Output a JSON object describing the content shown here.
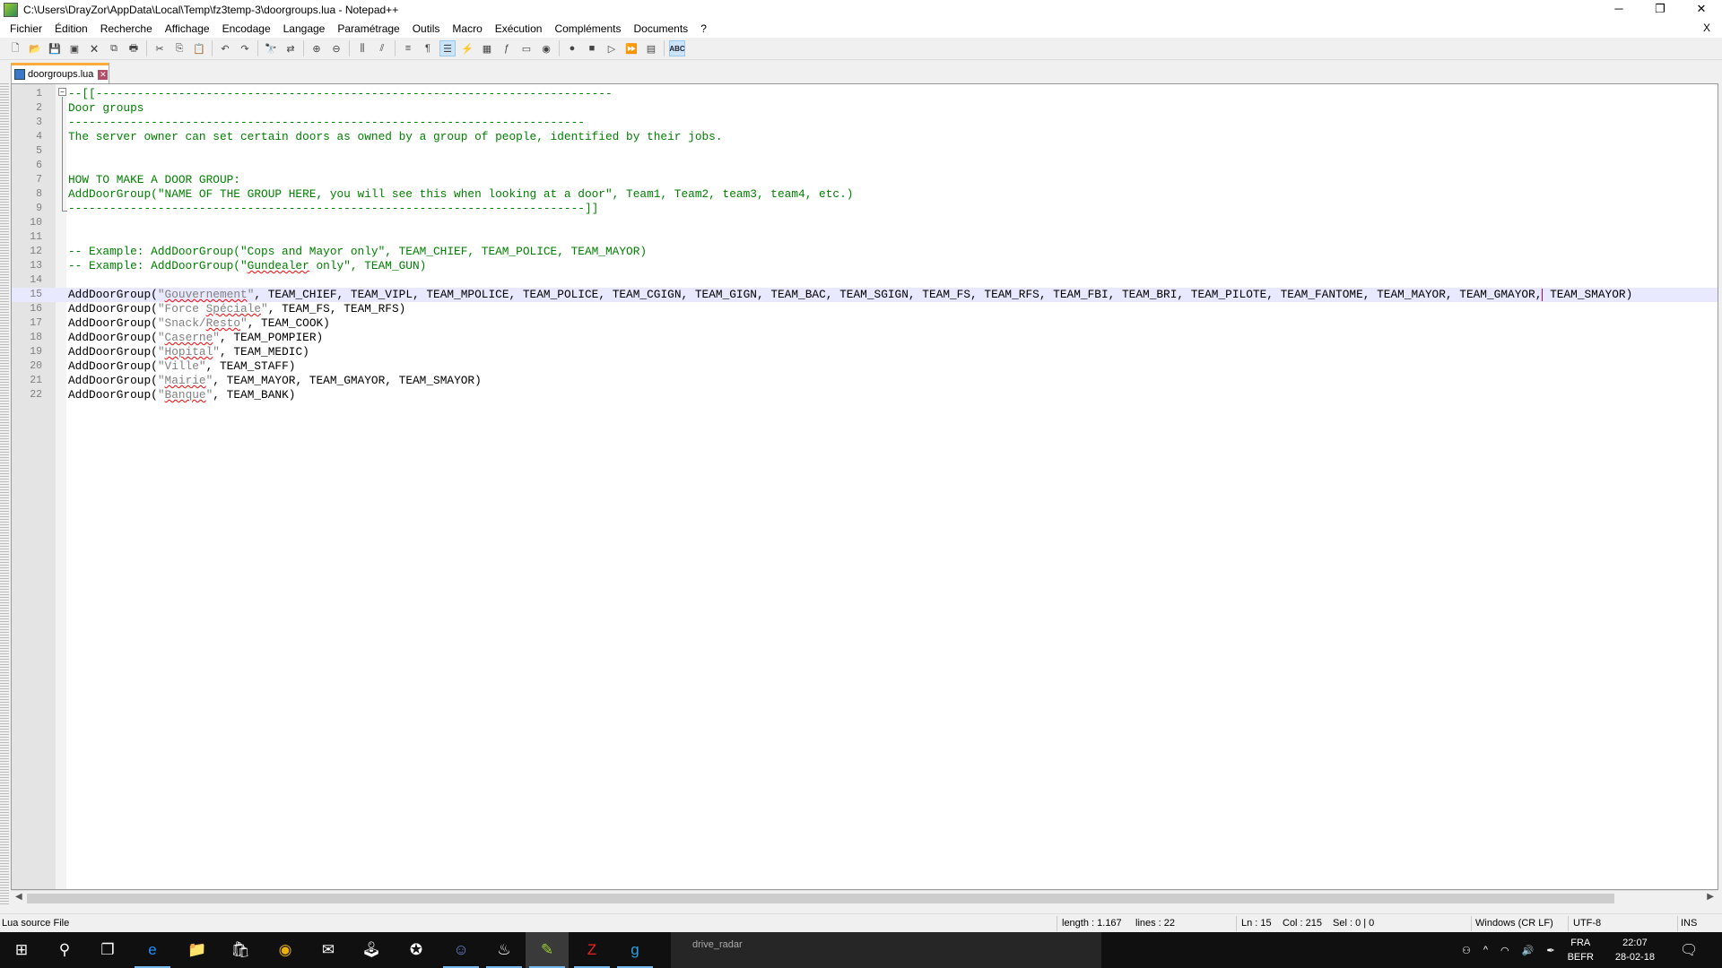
{
  "window": {
    "title": "C:\\Users\\DrayZor\\AppData\\Local\\Temp\\fz3temp-3\\doorgroups.lua - Notepad++",
    "minimize": "─",
    "restore": "❐",
    "close": "✕"
  },
  "menu": [
    "Fichier",
    "Édition",
    "Recherche",
    "Affichage",
    "Encodage",
    "Langage",
    "Paramétrage",
    "Outils",
    "Macro",
    "Exécution",
    "Compléments",
    "Documents",
    "?"
  ],
  "menu_close": "X",
  "toolbar": [
    {
      "icon": "new-file-icon",
      "g": "🗋"
    },
    {
      "icon": "open-file-icon",
      "g": "📂"
    },
    {
      "icon": "save-icon",
      "g": "💾"
    },
    {
      "icon": "save-all-icon",
      "g": "▣"
    },
    {
      "icon": "close-icon",
      "g": "🗙"
    },
    {
      "icon": "close-all-icon",
      "g": "⧉"
    },
    {
      "icon": "print-icon",
      "g": "🖶"
    },
    {
      "sep": true
    },
    {
      "icon": "cut-icon",
      "g": "✂"
    },
    {
      "icon": "copy-icon",
      "g": "⎘"
    },
    {
      "icon": "paste-icon",
      "g": "📋"
    },
    {
      "sep": true
    },
    {
      "icon": "undo-icon",
      "g": "↶"
    },
    {
      "icon": "redo-icon",
      "g": "↷"
    },
    {
      "sep": true
    },
    {
      "icon": "find-icon",
      "g": "🔭"
    },
    {
      "icon": "replace-icon",
      "g": "⇄"
    },
    {
      "sep": true
    },
    {
      "icon": "zoom-in-icon",
      "g": "⊕"
    },
    {
      "icon": "zoom-out-icon",
      "g": "⊖"
    },
    {
      "sep": true
    },
    {
      "icon": "sync-vertical-icon",
      "g": "⫼"
    },
    {
      "icon": "sync-horizontal-icon",
      "g": "⫽"
    },
    {
      "sep": true
    },
    {
      "icon": "word-wrap-icon",
      "g": "≡"
    },
    {
      "icon": "show-all-chars-icon",
      "g": "¶"
    },
    {
      "icon": "indent-guide-icon",
      "g": "☰",
      "active": true
    },
    {
      "icon": "udl-icon",
      "g": "⚡"
    },
    {
      "icon": "doc-map-icon",
      "g": "▦"
    },
    {
      "icon": "function-list-icon",
      "g": "ƒ"
    },
    {
      "icon": "folder-workspace-icon",
      "g": "▭"
    },
    {
      "icon": "monitoring-icon",
      "g": "◉"
    },
    {
      "sep": true
    },
    {
      "icon": "record-macro-icon",
      "g": "●"
    },
    {
      "icon": "stop-record-icon",
      "g": "■"
    },
    {
      "icon": "play-macro-icon",
      "g": "▷"
    },
    {
      "icon": "run-macro-multiple-icon",
      "g": "⏩"
    },
    {
      "icon": "save-macro-icon",
      "g": "▤"
    },
    {
      "sep": true
    },
    {
      "icon": "spell-check-icon",
      "g": "ABC",
      "active": true
    }
  ],
  "tab": {
    "label": "doorgroups.lua",
    "close": "✕"
  },
  "editor": {
    "current_line": 15,
    "lines": [
      [
        {
          "t": "--[[---------------------------------------------------------------------------",
          "c": "comment"
        }
      ],
      [
        {
          "t": "Door groups",
          "c": "comment"
        }
      ],
      [
        {
          "t": "---------------------------------------------------------------------------",
          "c": "comment"
        }
      ],
      [
        {
          "t": "The server owner can set certain doors as owned by a group of people, identified by their jobs.",
          "c": "comment"
        }
      ],
      [],
      [],
      [
        {
          "t": "HOW TO MAKE A DOOR GROUP:",
          "c": "comment"
        }
      ],
      [
        {
          "t": "AddDoorGroup(\"NAME OF THE GROUP HERE, you will see this when looking at a door\", Team1, Team2, team3, team4, etc.)",
          "c": "comment"
        }
      ],
      [
        {
          "t": "---------------------------------------------------------------------------]]",
          "c": "comment"
        }
      ],
      [],
      [],
      [
        {
          "t": "-- Example: AddDoorGroup(\"Cops and Mayor only\", TEAM_CHIEF, TEAM_POLICE, TEAM_MAYOR)",
          "c": "comment"
        }
      ],
      [
        {
          "t": "-- Example: AddDoorGroup(\"",
          "c": "comment"
        },
        {
          "t": "Gundealer",
          "c": "comment spell"
        },
        {
          "t": " only\", TEAM_GUN)",
          "c": "comment"
        }
      ],
      [],
      [
        {
          "t": "AddDoorGroup(",
          "c": ""
        },
        {
          "t": "\"",
          "c": "string"
        },
        {
          "t": "Gouvernement",
          "c": "string spell"
        },
        {
          "t": "\"",
          "c": "string"
        },
        {
          "t": ", TEAM_CHIEF, TEAM_VIPL, TEAM_MPOLICE, TEAM_POLICE, TEAM_CGIGN, TEAM_GIGN, TEAM_BAC, TEAM_SGIGN, TEAM_FS, TEAM_RFS, TEAM_FBI, TEAM_BRI, TEAM_PILOTE, TEAM_FANTOME, TEAM_MAYOR, TEAM_GMAYOR,",
          "c": ""
        },
        {
          "t": "",
          "c": "caret"
        },
        {
          "t": " TEAM_SMAYOR)",
          "c": ""
        }
      ],
      [
        {
          "t": "AddDoorGroup(",
          "c": ""
        },
        {
          "t": "\"Force ",
          "c": "string"
        },
        {
          "t": "Spéciale",
          "c": "string spell"
        },
        {
          "t": "\"",
          "c": "string"
        },
        {
          "t": ", TEAM_FS, TEAM_RFS)",
          "c": ""
        }
      ],
      [
        {
          "t": "AddDoorGroup(",
          "c": ""
        },
        {
          "t": "\"Snack/",
          "c": "string"
        },
        {
          "t": "Resto",
          "c": "string spell"
        },
        {
          "t": "\"",
          "c": "string"
        },
        {
          "t": ", TEAM_COOK)",
          "c": ""
        }
      ],
      [
        {
          "t": "AddDoorGroup(",
          "c": ""
        },
        {
          "t": "\"",
          "c": "string"
        },
        {
          "t": "Caserne",
          "c": "string spell"
        },
        {
          "t": "\"",
          "c": "string"
        },
        {
          "t": ", TEAM_POMPIER)",
          "c": ""
        }
      ],
      [
        {
          "t": "AddDoorGroup(",
          "c": ""
        },
        {
          "t": "\"",
          "c": "string"
        },
        {
          "t": "Hopital",
          "c": "string spell"
        },
        {
          "t": "\"",
          "c": "string"
        },
        {
          "t": ", TEAM_MEDIC)",
          "c": ""
        }
      ],
      [
        {
          "t": "AddDoorGroup(",
          "c": ""
        },
        {
          "t": "\"Ville\"",
          "c": "string"
        },
        {
          "t": ", TEAM_STAFF)",
          "c": ""
        }
      ],
      [
        {
          "t": "AddDoorGroup(",
          "c": ""
        },
        {
          "t": "\"",
          "c": "string"
        },
        {
          "t": "Mairie",
          "c": "string spell"
        },
        {
          "t": "\"",
          "c": "string"
        },
        {
          "t": ", TEAM_MAYOR, TEAM_GMAYOR, TEAM_SMAYOR)",
          "c": ""
        }
      ],
      [
        {
          "t": "AddDoorGroup(",
          "c": ""
        },
        {
          "t": "\"",
          "c": "string"
        },
        {
          "t": "Banque",
          "c": "string spell"
        },
        {
          "t": "\"",
          "c": "string"
        },
        {
          "t": ", TEAM_BANK)",
          "c": ""
        }
      ]
    ]
  },
  "status": {
    "filetype": "Lua source File",
    "length": "length : 1.167",
    "lines": "lines : 22",
    "ln": "Ln : 15",
    "col": "Col : 215",
    "sel": "Sel : 0 | 0",
    "eol": "Windows (CR LF)",
    "encoding": "UTF-8",
    "mode": "INS"
  },
  "taskbar": {
    "apps": [
      {
        "icon": "windows-start-icon",
        "g": "⊞"
      },
      {
        "icon": "search-icon",
        "g": "⚲"
      },
      {
        "icon": "task-view-icon",
        "g": "❐"
      },
      {
        "icon": "edge-icon",
        "g": "e",
        "color": "#1e90ff",
        "open": true
      },
      {
        "icon": "file-explorer-icon",
        "g": "📁"
      },
      {
        "icon": "store-icon",
        "g": "🛍"
      },
      {
        "icon": "chrome-icon",
        "g": "◉",
        "color": "#e8b10f"
      },
      {
        "icon": "mail-icon",
        "g": "✉"
      },
      {
        "icon": "game-icon",
        "g": "🕹"
      },
      {
        "icon": "rockstar-icon",
        "g": "✪"
      },
      {
        "icon": "discord-icon",
        "g": "☺",
        "color": "#7289da",
        "open": true
      },
      {
        "icon": "steam-icon",
        "g": "♨",
        "open": true
      },
      {
        "icon": "notepadpp-icon",
        "g": "✎",
        "color": "#9acd32",
        "open": true,
        "active": true
      },
      {
        "icon": "filezilla-icon",
        "g": "Z",
        "color": "#e22",
        "open": true
      },
      {
        "icon": "g-app-icon",
        "g": "g",
        "color": "#2aa0e0",
        "open": true
      }
    ],
    "preview_text": "drive_radar",
    "lang": "FRA",
    "layout": "BEFR",
    "time": "22:07",
    "date": "28-02-18"
  }
}
